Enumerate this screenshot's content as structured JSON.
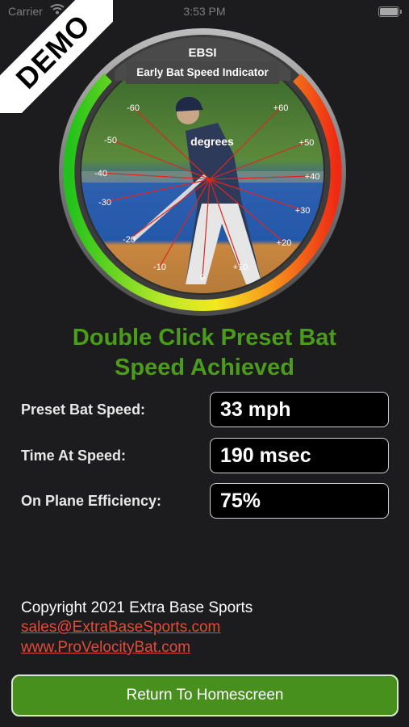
{
  "status": {
    "carrier": "Carrier",
    "time": "3:53 PM"
  },
  "demo_label": "DEMO",
  "gauge": {
    "title": "EBSI",
    "subtitle": "Early Bat Speed Indicator",
    "center_label": "degrees",
    "angle_labels": [
      "-60",
      "-50",
      "-40",
      "-30",
      "-20",
      "-10",
      "0",
      "+10",
      "+20",
      "+30",
      "+40",
      "+50",
      "+60"
    ]
  },
  "headline": {
    "line1": "Double Click Preset Bat",
    "line2": "Speed Achieved"
  },
  "metrics": [
    {
      "label": "Preset Bat Speed:",
      "value": "33 mph"
    },
    {
      "label": "Time At Speed:",
      "value": "190 msec"
    },
    {
      "label": "On Plane Efficiency:",
      "value": "75%"
    }
  ],
  "footer": {
    "copyright": "Copyright 2021 Extra Base Sports",
    "email": "sales@ExtraBaseSports.com",
    "website": "www.ProVelocityBat.com"
  },
  "home_button": "Return To Homescreen",
  "colors": {
    "background": "#1c1c1e",
    "headline": "#4c9c1c",
    "link": "#e34a3a",
    "button": "#48901d"
  }
}
